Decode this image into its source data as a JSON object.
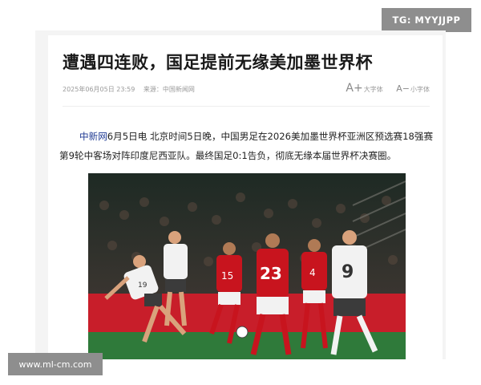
{
  "watermarks": {
    "top_right": "TG: MYYJJPP",
    "bottom_left": "www.ml-cm.com"
  },
  "article": {
    "title": "遭遇四连败，国足提前无缘美加墨世界杯",
    "date": "2025年06月05日 23:59",
    "source_label": "来源：中国新闻网",
    "font_large": "大字体",
    "font_small": "小字体",
    "lead_source": "中新网",
    "lead_text": "6月5日电 北京时间5日晚，中国男足在2026美加墨世界杯亚洲区预选赛18强赛第9轮中客场对阵印度尼西亚队。最终国足0:1告负，彻底无缘本届世界杯决赛圈。"
  },
  "photo": {
    "jersey_numbers": [
      "19",
      "23",
      "9",
      "15",
      "4"
    ],
    "colors": {
      "china_kit": "#f2f2f2",
      "indonesia_kit": "#c8141e",
      "pitch": "#2f7a3a",
      "board": "#c81e2a"
    }
  }
}
